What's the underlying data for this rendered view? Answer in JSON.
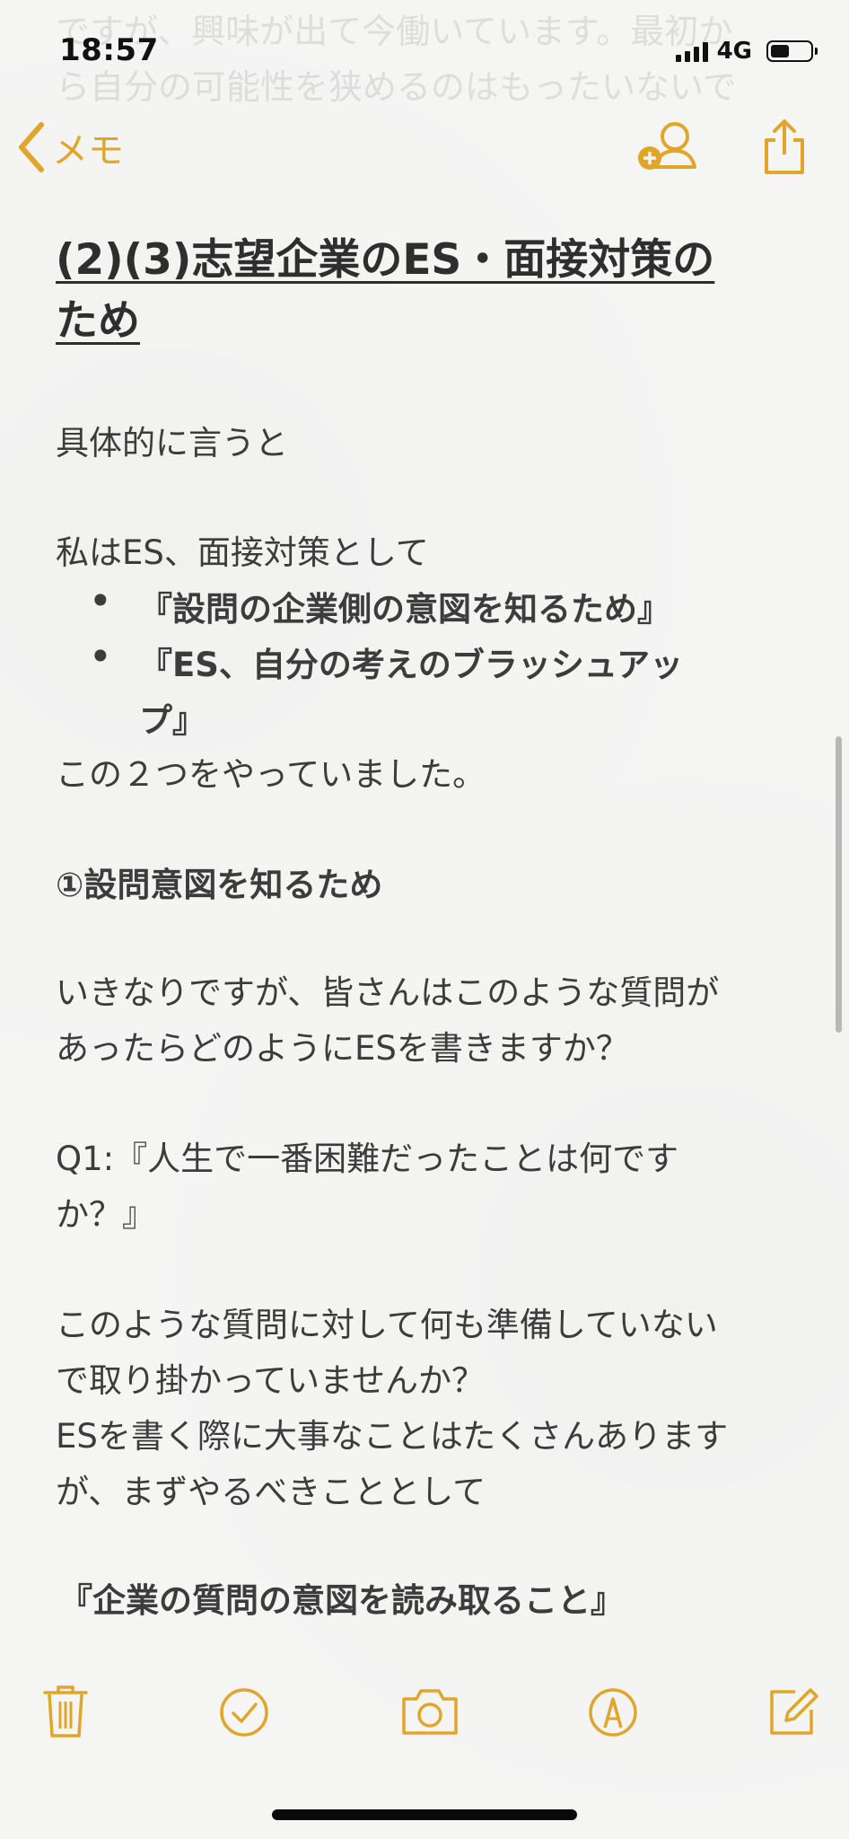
{
  "status_bar": {
    "time": "18:57",
    "network": "4G"
  },
  "ghost_lines": [
    "ですが、興味が出て今働いています。最初か",
    "ら自分の可能性を狭めるのはもったいないで"
  ],
  "nav": {
    "back_label": "メモ"
  },
  "note": {
    "heading_line1": "(2)(3)志望企業のES・面接対策の",
    "heading_line2": "ため",
    "p1": "具体的に言うと",
    "p2": "私はES、面接対策として",
    "bullets": [
      "『設問の企業側の意図を知るため』",
      "『ES、自分の考えのブラッシュアッ",
      "プ』"
    ],
    "p3": "この２つをやっていました。",
    "section1": "①設問意図を知るため",
    "p4_line1": "いきなりですが、皆さんはこのような質問が",
    "p4_line2": "あったらどのようにESを書きますか？",
    "q1_line1": "Q1:『人生で一番困難だったことは何です",
    "q1_line2": "か？』",
    "p5_line1": "このような質問に対して何も準備していない",
    "p5_line2": "で取り掛かっていませんか？",
    "p5_line3": "ESを書く際に大事なことはたくさんあります",
    "p5_line4": "が、まずやるべきこととして",
    "emphasis": "『企業の質問の意図を読み取ること』"
  },
  "colors": {
    "accent": "#e0a52a",
    "text": "#3c3c3c",
    "background": "#f5f5f4"
  },
  "icons": {
    "back": "chevron-left-icon",
    "add_person": "add-person-icon",
    "share": "share-icon",
    "trash": "trash-icon",
    "check": "checklist-icon",
    "camera": "camera-icon",
    "markup": "markup-pen-icon",
    "compose": "compose-icon"
  }
}
